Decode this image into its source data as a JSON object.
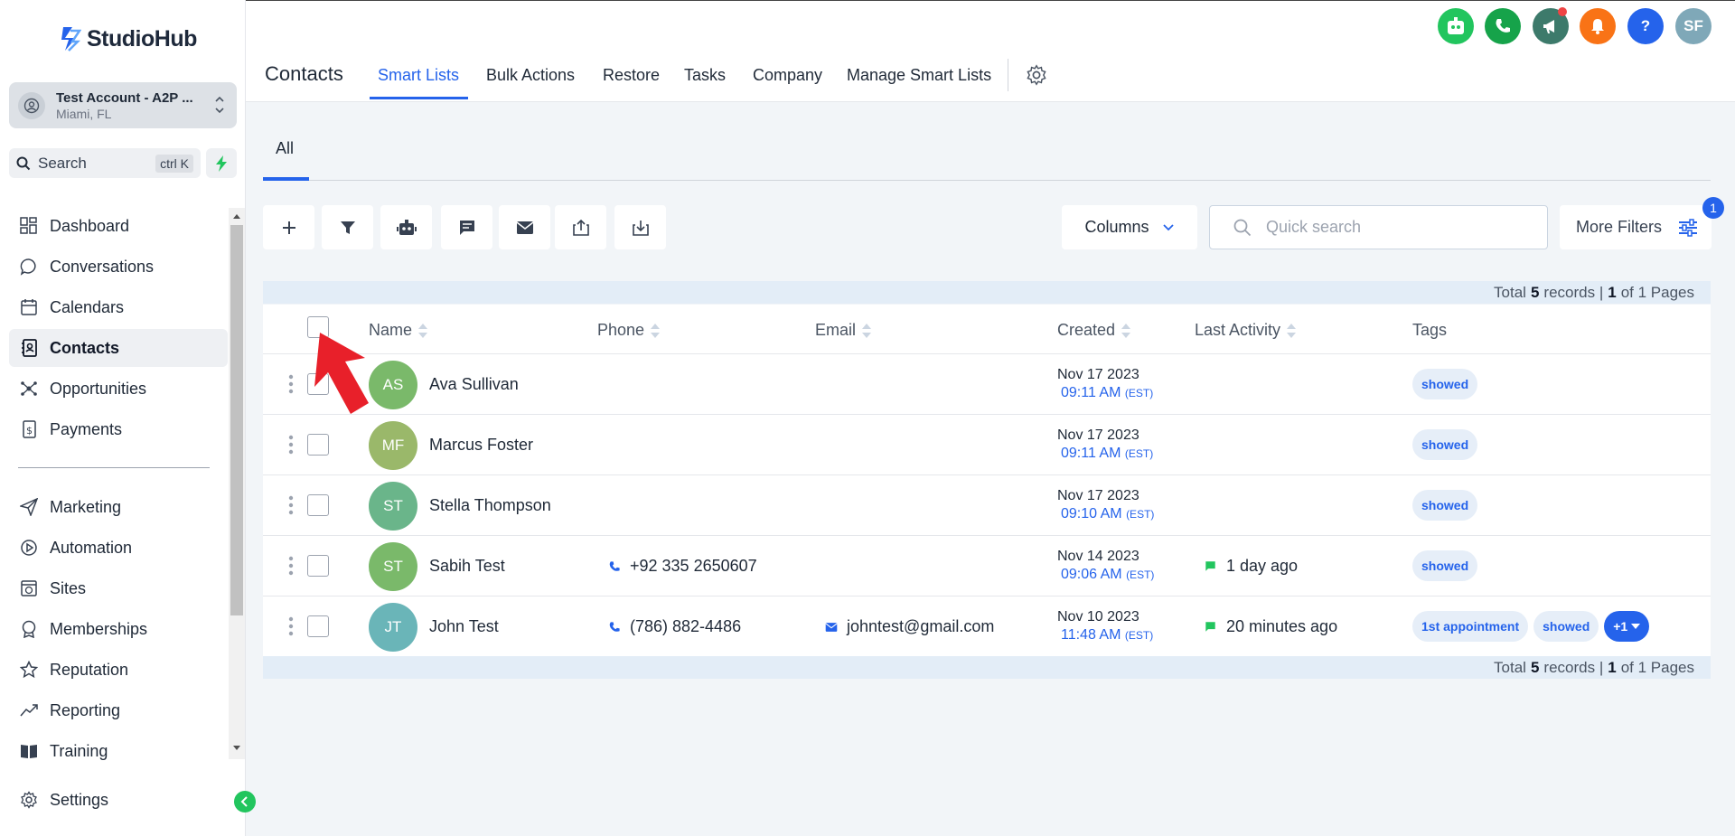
{
  "app": {
    "name": "StudioHub"
  },
  "account": {
    "name": "Test Account - A2P ...",
    "location": "Miami, FL"
  },
  "search": {
    "label": "Search",
    "shortcut": "ctrl K"
  },
  "sidebar": {
    "items": [
      {
        "label": "Dashboard",
        "icon": "dashboard-icon"
      },
      {
        "label": "Conversations",
        "icon": "chat-icon"
      },
      {
        "label": "Calendars",
        "icon": "calendar-icon"
      },
      {
        "label": "Contacts",
        "icon": "contacts-icon",
        "active": true
      },
      {
        "label": "Opportunities",
        "icon": "opportunities-icon"
      },
      {
        "label": "Payments",
        "icon": "payments-icon"
      },
      {
        "label": "Marketing",
        "icon": "send-icon"
      },
      {
        "label": "Automation",
        "icon": "automation-icon"
      },
      {
        "label": "Sites",
        "icon": "sites-icon"
      },
      {
        "label": "Memberships",
        "icon": "badge-icon"
      },
      {
        "label": "Reputation",
        "icon": "star-icon"
      },
      {
        "label": "Reporting",
        "icon": "trend-icon"
      },
      {
        "label": "Training",
        "icon": "book-icon"
      }
    ],
    "settings_label": "Settings"
  },
  "header": {
    "title": "Contacts",
    "tabs": [
      "Smart Lists",
      "Bulk Actions",
      "Restore",
      "Tasks",
      "Company",
      "Manage Smart Lists"
    ],
    "user_initials": "SF",
    "icon_colors": {
      "bot": "#22c55e",
      "phone": "#16a34a",
      "megaphone": "#3d7a6b",
      "bell": "#f97316",
      "help": "#2563eb",
      "user": "#7fa8b8"
    }
  },
  "subtabs": {
    "all": "All"
  },
  "toolbar": {
    "columns_label": "Columns",
    "quick_search_placeholder": "Quick search",
    "more_filters_label": "More Filters",
    "filter_count": "1"
  },
  "records": {
    "prefix": "Total",
    "count": "5",
    "middle": "records |",
    "page": "1",
    "suffix": "of 1 Pages"
  },
  "table": {
    "columns": [
      "Name",
      "Phone",
      "Email",
      "Created",
      "Last Activity",
      "Tags"
    ],
    "rows": [
      {
        "initials": "AS",
        "name": "Ava Sullivan",
        "phone": "",
        "email": "",
        "date": "Nov 17 2023",
        "time": "09:11 AM",
        "tz": "(EST)",
        "activity": "",
        "tags": [
          "showed"
        ],
        "avatar_color": "#7ab96a"
      },
      {
        "initials": "MF",
        "name": "Marcus Foster",
        "phone": "",
        "email": "",
        "date": "Nov 17 2023",
        "time": "09:11 AM",
        "tz": "(EST)",
        "activity": "",
        "tags": [
          "showed"
        ],
        "avatar_color": "#9ab86a"
      },
      {
        "initials": "ST",
        "name": "Stella Thompson",
        "phone": "",
        "email": "",
        "date": "Nov 17 2023",
        "time": "09:10 AM",
        "tz": "(EST)",
        "activity": "",
        "tags": [
          "showed"
        ],
        "avatar_color": "#6ab58a"
      },
      {
        "initials": "ST",
        "name": "Sabih Test",
        "phone": "+92 335 2650607",
        "email": "",
        "date": "Nov 14 2023",
        "time": "09:06 AM",
        "tz": "(EST)",
        "activity": "1 day ago",
        "tags": [
          "showed"
        ],
        "avatar_color": "#7ab96a"
      },
      {
        "initials": "JT",
        "name": "John Test",
        "phone": "(786) 882-4486",
        "email": "johntest@gmail.com",
        "date": "Nov 10 2023",
        "time": "11:48 AM",
        "tz": "(EST)",
        "activity": "20 minutes ago",
        "tags": [
          "1st appointment",
          "showed"
        ],
        "more_tags": "+1",
        "avatar_color": "#6ab5b8"
      }
    ]
  }
}
